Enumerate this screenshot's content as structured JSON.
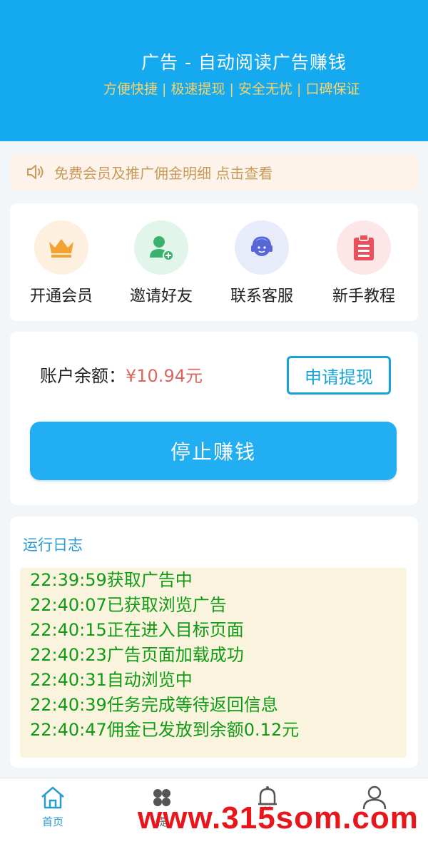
{
  "header": {
    "title": "广告 - 自动阅读广告赚钱",
    "subtitle": "方便快捷 | 极速提现 | 安全无忧 | 口碑保证"
  },
  "notice": {
    "icon": "speaker-icon",
    "text": "免费会员及推广佣金明细 点击查看"
  },
  "menu": {
    "items": [
      {
        "label": "开通会员",
        "icon": "crown-icon",
        "bg": "#fdf0df",
        "color": "#f2a331"
      },
      {
        "label": "邀请好友",
        "icon": "add-user-icon",
        "bg": "#e1f5ea",
        "color": "#3bb16e"
      },
      {
        "label": "联系客服",
        "icon": "customer-service-icon",
        "bg": "#e8ebfa",
        "color": "#5867d8"
      },
      {
        "label": "新手教程",
        "icon": "clipboard-icon",
        "bg": "#fce6e8",
        "color": "#e8505b"
      }
    ]
  },
  "account": {
    "balance_label": "账户余额：",
    "balance_value": "¥10.94元",
    "withdraw_label": "申请提现",
    "stop_label": "停止赚钱"
  },
  "log": {
    "title": "运行日志",
    "lines": [
      "22:39:59获取广告中",
      "22:40:07已获取浏览广告",
      "22:40:15正在进入目标页面",
      "22:40:23广告页面加载成功",
      "22:40:31自动浏览中",
      "22:40:39任务完成等待返回信息",
      "22:40:47佣金已发放到余额0.12元"
    ]
  },
  "tabbar": {
    "tabs": [
      {
        "label": "首页",
        "icon": "home-icon",
        "active": true
      },
      {
        "label": "提",
        "icon": "apps-icon",
        "active": false
      },
      {
        "label": "",
        "icon": "bell-icon",
        "active": false
      },
      {
        "label": "",
        "icon": "user-icon",
        "active": false
      }
    ]
  },
  "watermark": "www.315som.com",
  "colors": {
    "brand": "#15a9f0",
    "accent": "#2a9bd1",
    "log_text": "#0f9b13",
    "balance": "#d9665f"
  }
}
